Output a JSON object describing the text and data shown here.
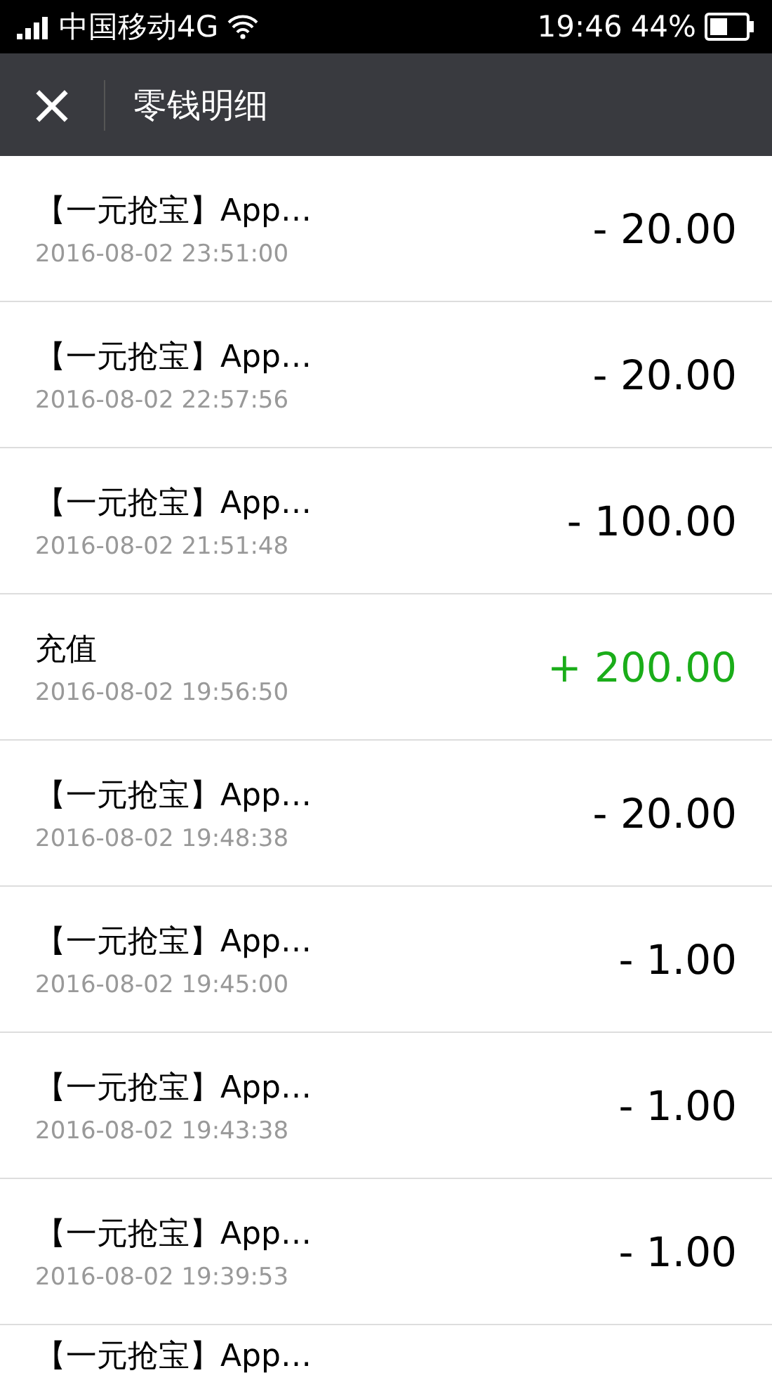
{
  "status_bar": {
    "carrier": "中国移动4G",
    "time": "19:46",
    "battery": "44%"
  },
  "header": {
    "close": "×",
    "title": "零钱明细"
  },
  "transactions": [
    {
      "title": "【一元抢宝】App…",
      "date": "2016-08-02 23:51:00",
      "amount": "- 20.00",
      "kind": "expense"
    },
    {
      "title": "【一元抢宝】App…",
      "date": "2016-08-02 22:57:56",
      "amount": "- 20.00",
      "kind": "expense"
    },
    {
      "title": "【一元抢宝】App…",
      "date": "2016-08-02 21:51:48",
      "amount": "- 100.00",
      "kind": "expense"
    },
    {
      "title": "充值",
      "date": "2016-08-02 19:56:50",
      "amount": "+ 200.00",
      "kind": "income"
    },
    {
      "title": "【一元抢宝】App…",
      "date": "2016-08-02 19:48:38",
      "amount": "- 20.00",
      "kind": "expense"
    },
    {
      "title": "【一元抢宝】App…",
      "date": "2016-08-02 19:45:00",
      "amount": "- 1.00",
      "kind": "expense"
    },
    {
      "title": "【一元抢宝】App…",
      "date": "2016-08-02 19:43:38",
      "amount": "- 1.00",
      "kind": "expense"
    },
    {
      "title": "【一元抢宝】App…",
      "date": "2016-08-02 19:39:53",
      "amount": "- 1.00",
      "kind": "expense"
    },
    {
      "title": "【一元抢宝】App…"
    }
  ]
}
